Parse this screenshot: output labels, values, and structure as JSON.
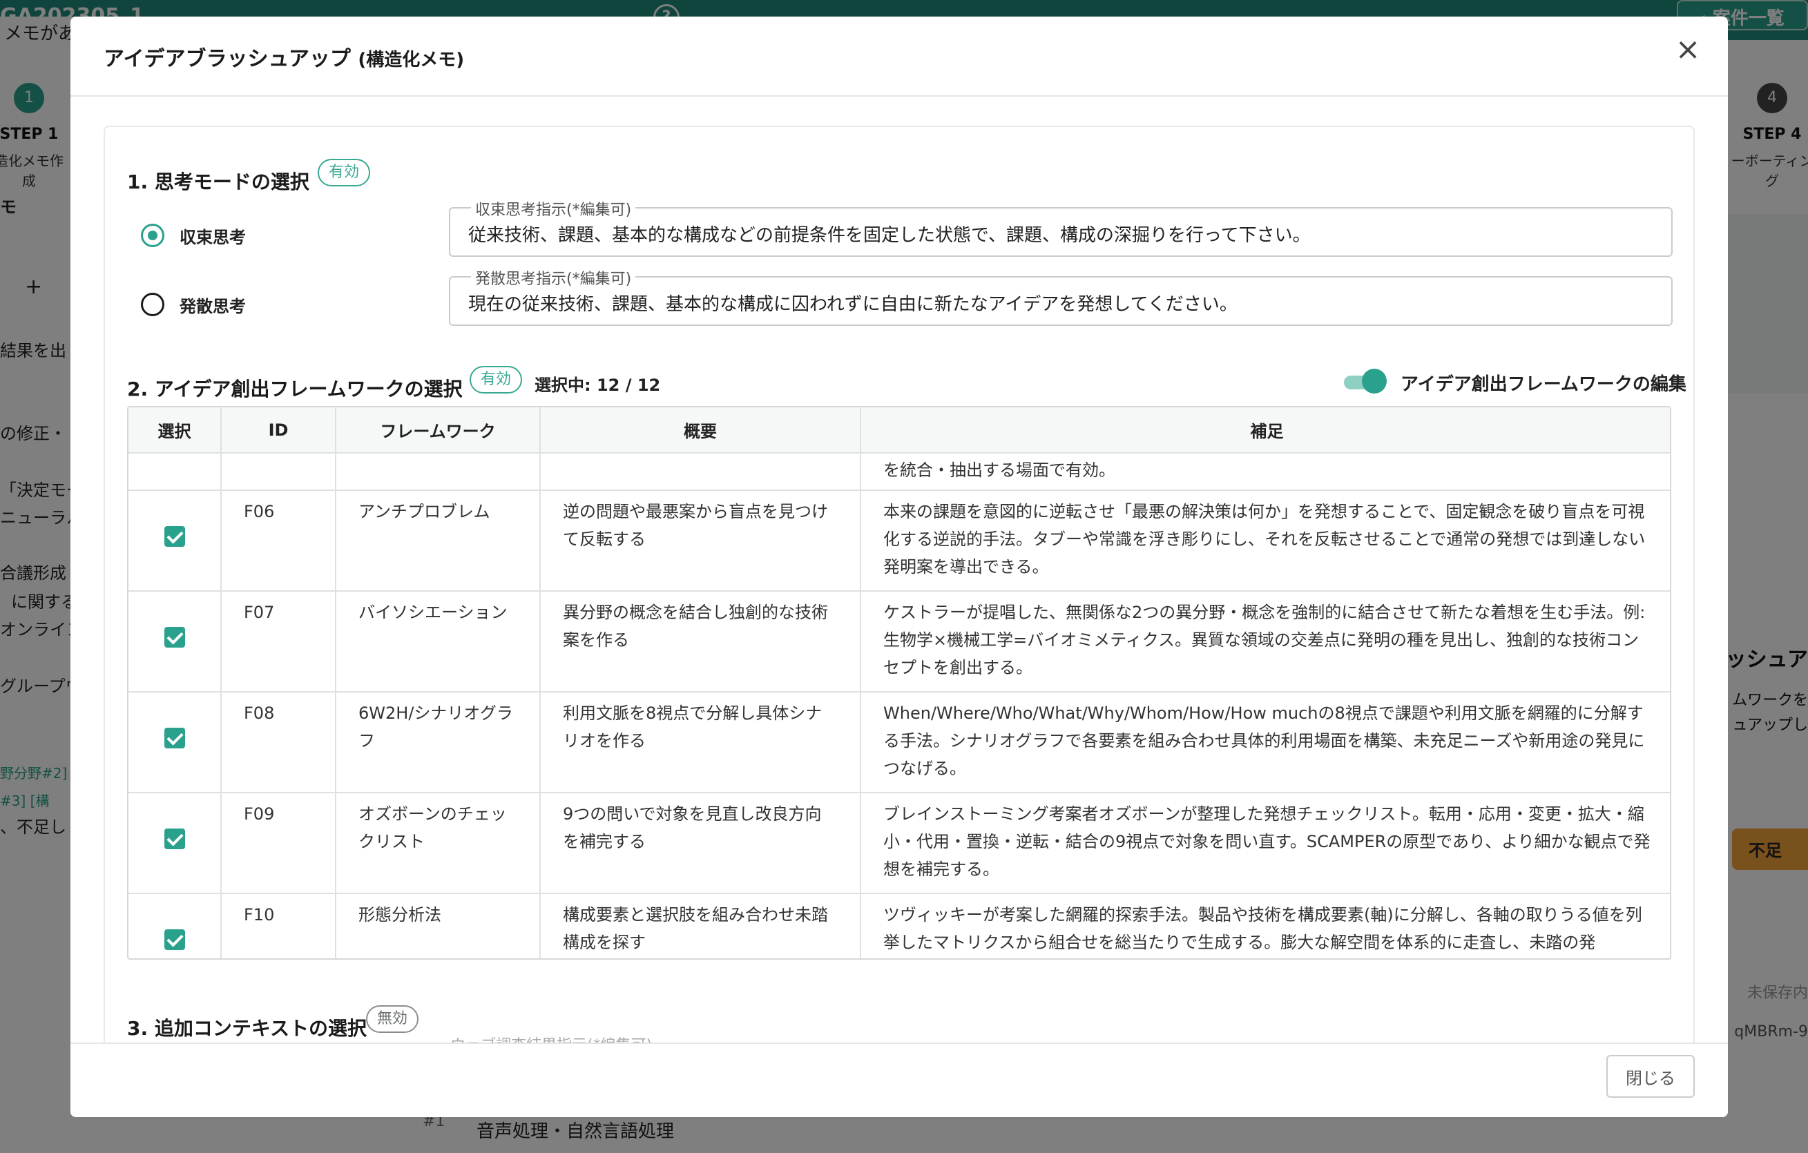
{
  "background": {
    "project_name": "GA202305_1",
    "back_button": "案件一覧",
    "memo_row": "メモがあ",
    "steps": [
      {
        "num": "1",
        "title": "STEP 1",
        "sub": "造化メモ作成"
      },
      {
        "num": "4",
        "title": "STEP 4",
        "sub": "ーボーティング"
      }
    ],
    "left_texts": [
      "モ",
      "+",
      "結果を出",
      "の修正・",
      "「決定モー",
      "ニューラル",
      "合議形成",
      "に関する",
      "オンライン",
      "グループウ",
      "野分野#2]",
      "#3] [構",
      "、不足し"
    ],
    "right_texts": [
      "ッシュア",
      "ムワークを",
      "ュアップし"
    ],
    "right_button": "不足",
    "right_status": "未保存内",
    "right_id": "qMBRm-9",
    "bottom_row_num": "#1",
    "bottom_text": "音声処理・自然言語処理"
  },
  "modal": {
    "title": "アイデアブラッシュアップ",
    "title_sub": "(構造化メモ)",
    "section1": {
      "title": "1. 思考モードの選択",
      "status": "有効",
      "options": [
        {
          "label": "収束思考",
          "selected": true,
          "field_label": "収束思考指示(*編集可)",
          "field_value": "従来技術、課題、基本的な構成などの前提条件を固定した状態で、課題、構成の深掘りを行って下さい。"
        },
        {
          "label": "発散思考",
          "selected": false,
          "field_label": "発散思考指示(*編集可)",
          "field_value": "現在の従来技術、課題、基本的な構成に囚われずに自由に新たなアイデアを発想してください。"
        }
      ]
    },
    "section2": {
      "title": "2. アイデア創出フレームワークの選択",
      "status": "有効",
      "selected_count": "選択中: 12 / 12",
      "toggle_label": "アイデア創出フレームワークの編集",
      "toggle_on": true,
      "table": {
        "headers": [
          "選択",
          "ID",
          "フレームワーク",
          "概要",
          "補足"
        ],
        "partial_row_note": "を統合・抽出する場面で有効。",
        "rows": [
          {
            "id": "F06",
            "framework": "アンチプロブレム",
            "summary": "逆の問題や最悪案から盲点を見つけて反転する",
            "note": "本来の課題を意図的に逆転させ「最悪の解決策は何か」を発想することで、固定観念を破り盲点を可視化する逆説的手法。タブーや常識を浮き彫りにし、それを反転させることで通常の発想では到達しない発明案を導出できる。",
            "checked": true
          },
          {
            "id": "F07",
            "framework": "バイソシエーション",
            "summary": "異分野の概念を結合し独創的な技術案を作る",
            "note": "ケストラーが提唱した、無関係な2つの異分野・概念を強制的に結合させて新たな着想を生む手法。例:生物学×機械工学=バイオミメティクス。異質な領域の交差点に発明の種を見出し、独創的な技術コンセプトを創出する。",
            "checked": true
          },
          {
            "id": "F08",
            "framework": "6W2H/シナリオグラフ",
            "summary": "利用文脈を8視点で分解し具体シナリオを作る",
            "note": "When/Where/Who/What/Why/Whom/How/How muchの8視点で課題や利用文脈を網羅的に分解する手法。シナリオグラフで各要素を組み合わせ具体的利用場面を構築、未充足ニーズや新用途の発見につなげる。",
            "checked": true
          },
          {
            "id": "F09",
            "framework": "オズボーンのチェックリスト",
            "summary": "9つの問いで対象を見直し改良方向を補完する",
            "note": "ブレインストーミング考案者オズボーンが整理した発想チェックリスト。転用・応用・変更・拡大・縮小・代用・置換・逆転・結合の9視点で対象を問い直す。SCAMPERの原型であり、より細かな観点で発想を補完する。",
            "checked": true
          },
          {
            "id": "F10",
            "framework": "形態分析法",
            "summary": "構成要素と選択肢を組み合わせ未踏構成を探す",
            "note": "ツヴィッキーが考案した網羅的探索手法。製品や技術を構成要素(軸)に分解し、各軸の取りうる値を列挙したマトリクスから組合せを総当たりで生成する。膨大な解空間を体系的に走査し、未踏の発",
            "checked": true
          }
        ]
      }
    },
    "section3": {
      "title": "3. 追加コンテキストの選択",
      "status": "無効",
      "hint": "ウェブ調査結果指示(*編集可)"
    },
    "close_button": "閉じる",
    "close_icon_label": "×"
  },
  "colors": {
    "accent": "#2aa18c",
    "topbar": "#1f8a78"
  }
}
